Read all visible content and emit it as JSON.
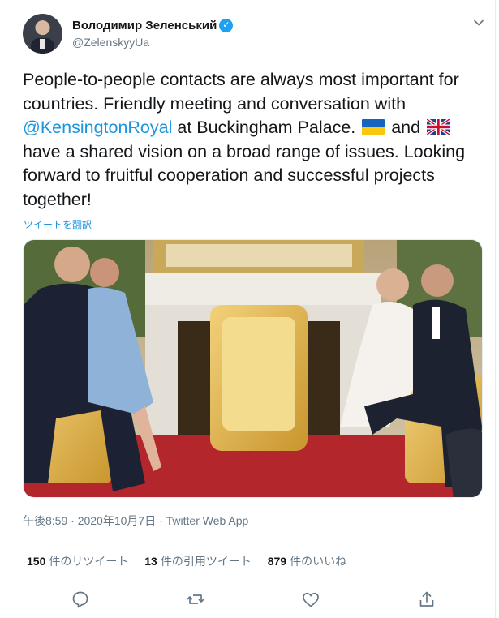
{
  "user": {
    "display_name": "Володимир Зеленський",
    "handle": "@ZelenskyyUa",
    "verified": true
  },
  "tweet": {
    "text_part1": "People-to-people contacts are always most important for countries. Friendly meeting and conversation with ",
    "mention": "@KensingtonRoyal",
    "text_part2": " at Buckingham Palace. ",
    "text_part3": " and ",
    "text_part4": " have a shared vision on a broad range of issues. Looking forward to fruitful cooperation and successful projects together!",
    "flags": [
      "ukraine-flag",
      "uk-flag"
    ],
    "translate_link": "ツイートを翻訳"
  },
  "meta": {
    "timestamp": "午後8:59 · 2020年10月7日 · Twitter Web App"
  },
  "stats": {
    "retweets_count": "150",
    "retweets_label": "件のリツイート",
    "quotes_count": "13",
    "quotes_label": "件の引用ツイート",
    "likes_count": "879",
    "likes_label": "件のいいね"
  },
  "actions": [
    "reply-icon",
    "retweet-icon",
    "like-icon",
    "share-icon"
  ],
  "colors": {
    "link": "#1b95e0",
    "muted": "#657786",
    "text": "#14171a",
    "verified": "#1da1f2"
  }
}
